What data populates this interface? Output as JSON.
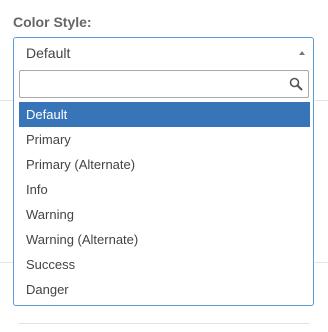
{
  "field": {
    "label": "Color Style:"
  },
  "select": {
    "value": "Default"
  },
  "search": {
    "placeholder": "",
    "value": ""
  },
  "options": [
    {
      "label": "Default",
      "selected": true
    },
    {
      "label": "Primary",
      "selected": false
    },
    {
      "label": "Primary (Alternate)",
      "selected": false
    },
    {
      "label": "Info",
      "selected": false
    },
    {
      "label": "Warning",
      "selected": false
    },
    {
      "label": "Warning (Alternate)",
      "selected": false
    },
    {
      "label": "Success",
      "selected": false
    },
    {
      "label": "Danger",
      "selected": false
    }
  ],
  "colors": {
    "accent": "#5b9dd9",
    "highlight": "#3875b8"
  },
  "icons": {
    "search": "search-icon",
    "arrow": "caret-up-icon"
  }
}
